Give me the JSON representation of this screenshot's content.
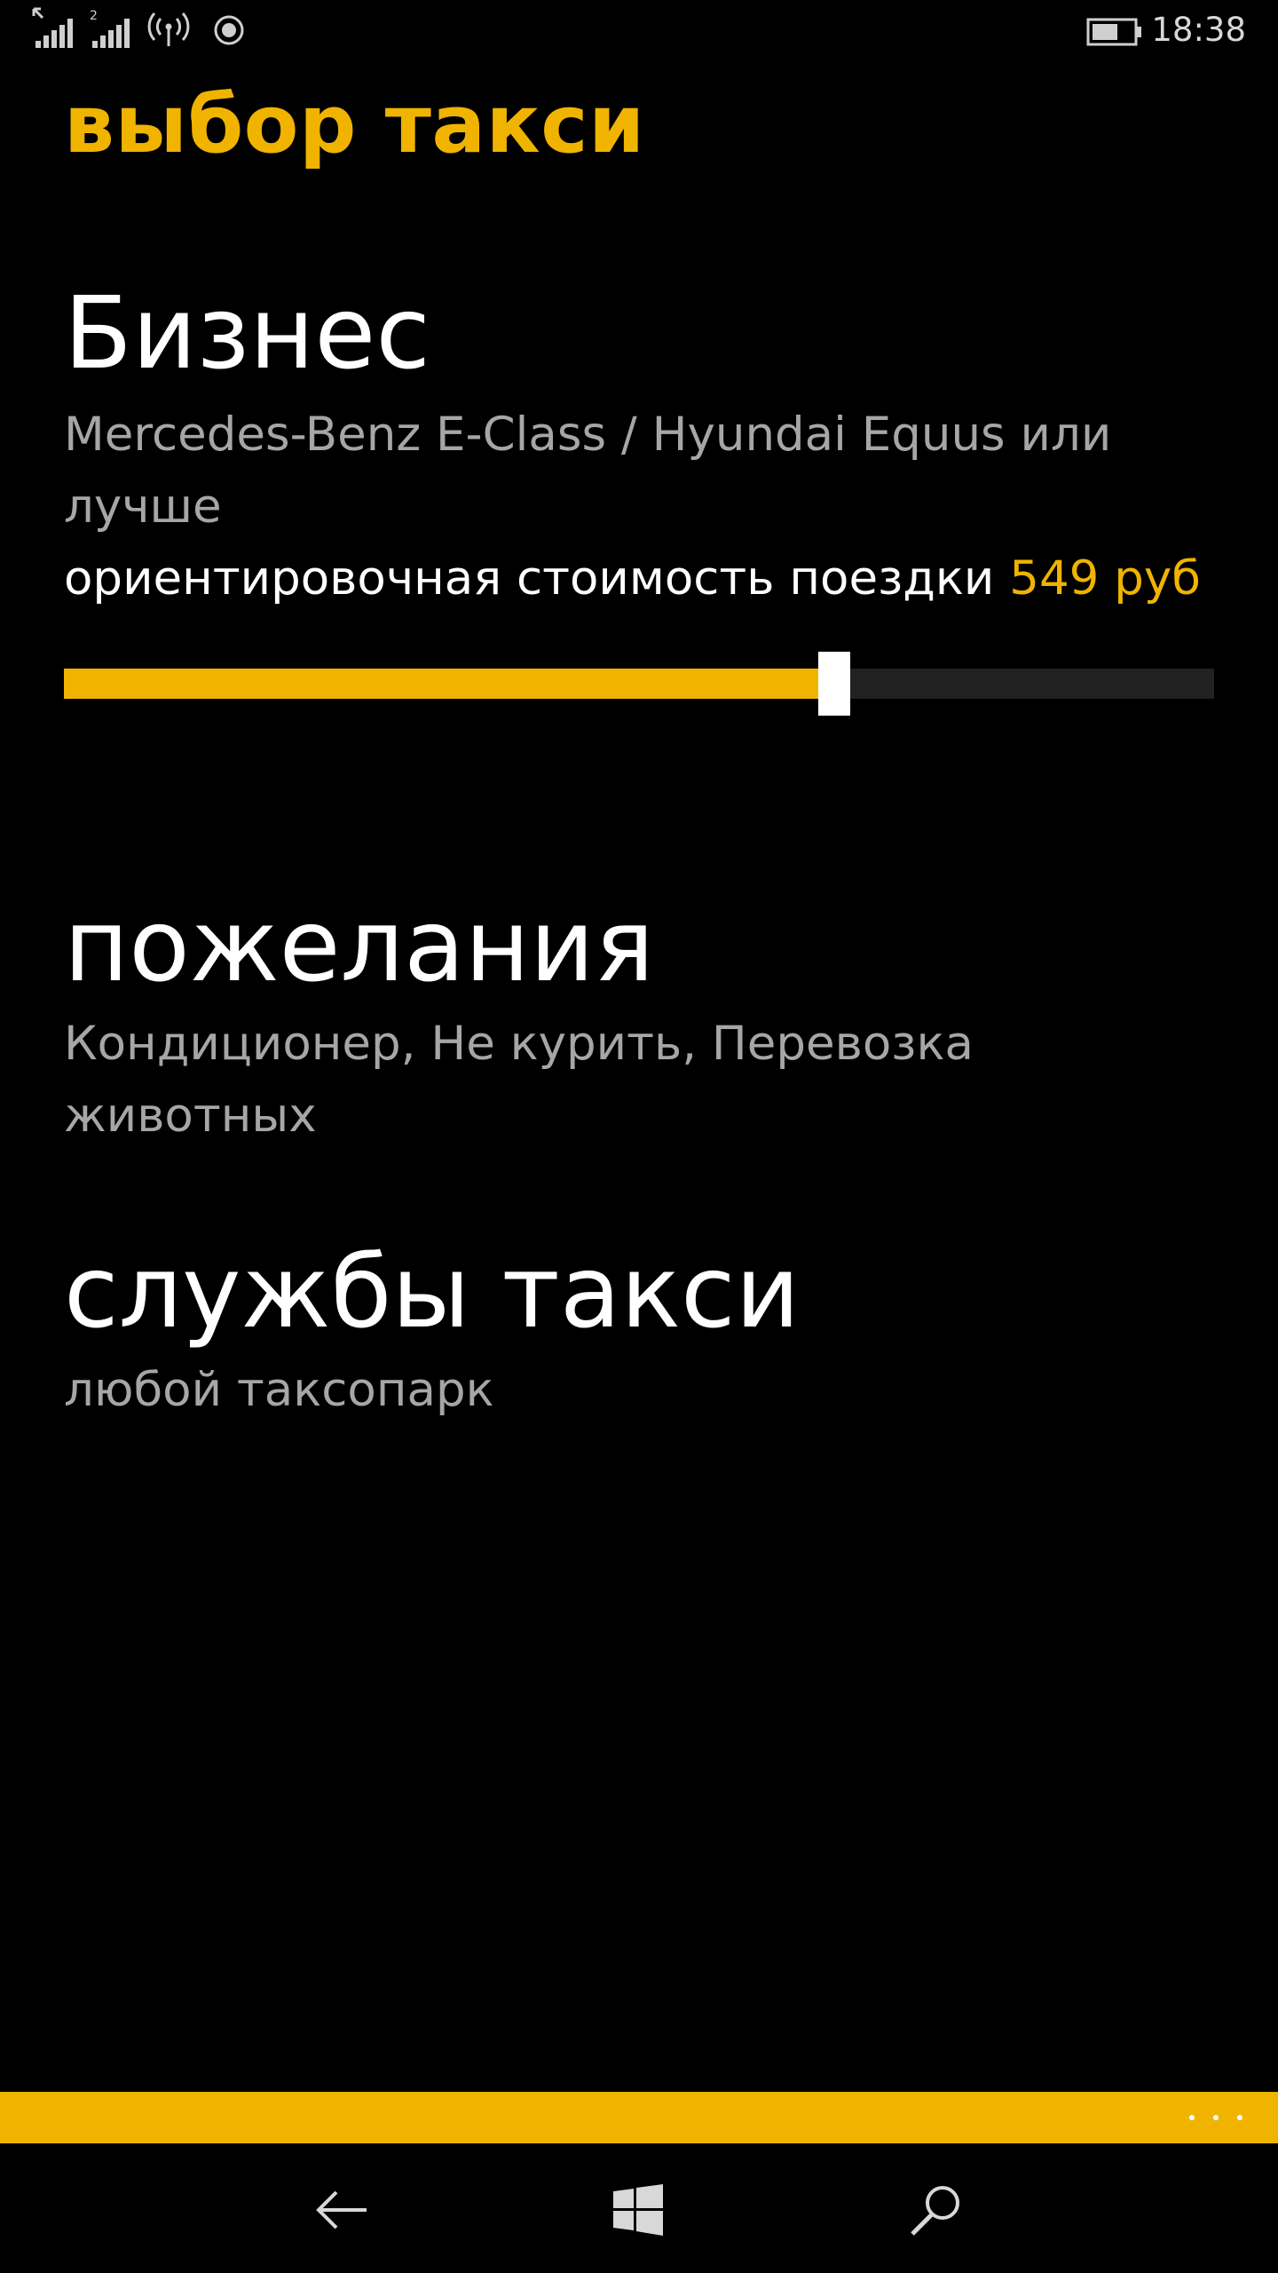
{
  "status_bar": {
    "time": "18:38",
    "sim2_label": "2",
    "icons": [
      "signal-sim1-icon",
      "signal-sim2-icon",
      "wifi-icon",
      "recording-icon",
      "battery-icon"
    ]
  },
  "header": {
    "title": "выбор такси"
  },
  "tariff": {
    "name": "Бизнес",
    "cars": "Mercedes-Benz E-Class / Hyundai Equus или лучше",
    "cost_label": "ориентировочная стоимость поездки",
    "cost_value": "549 руб",
    "slider_level": 0.67
  },
  "wishes": {
    "heading": "пожелания",
    "values": "Кондиционер, Не курить, Перевозка животных"
  },
  "services": {
    "heading": "службы такси",
    "value": "любой таксопарк"
  },
  "app_bar": {
    "more_icon": "ellipsis-icon"
  },
  "nav_bar": {
    "icons": [
      "back-arrow-icon",
      "windows-start-icon",
      "search-icon"
    ]
  },
  "colors": {
    "accent": "#f0b400",
    "background": "#000000",
    "secondary_text": "#a6a6a6",
    "track": "#212121"
  }
}
